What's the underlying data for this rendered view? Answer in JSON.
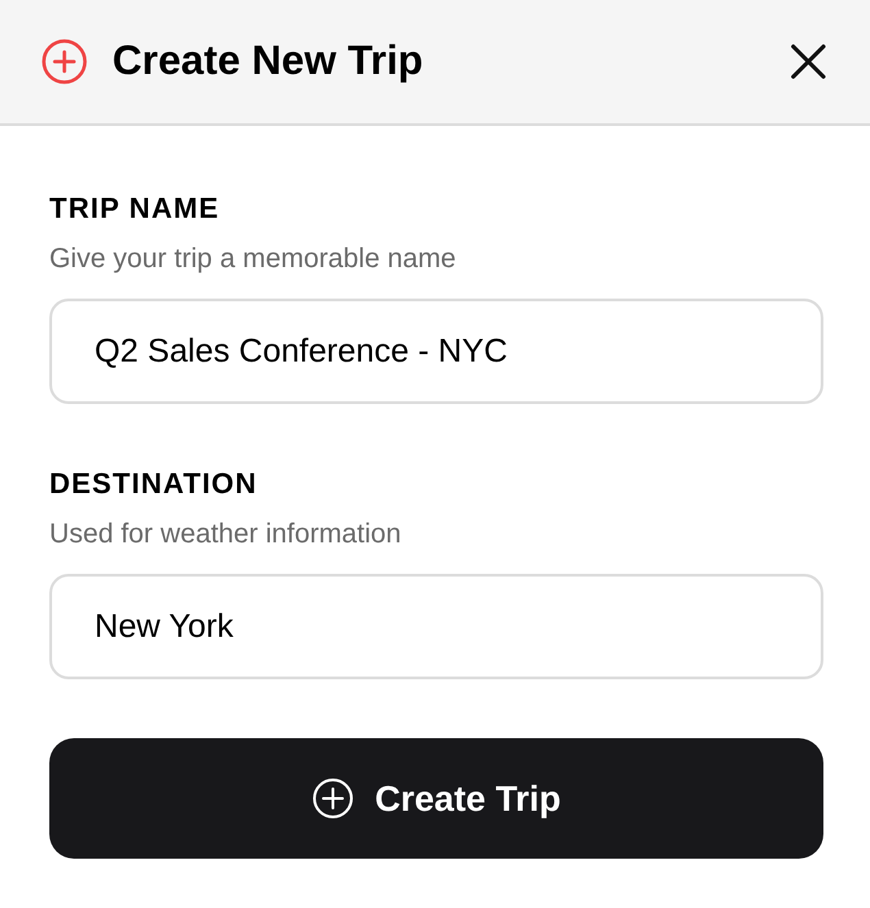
{
  "header": {
    "title": "Create New Trip"
  },
  "fields": [
    {
      "label": "TRIP NAME",
      "hint": "Give your trip a memorable name",
      "value": "Q2 Sales Conference - NYC"
    },
    {
      "label": "DESTINATION",
      "hint": "Used for weather information",
      "value": "New York"
    }
  ],
  "submit_button": {
    "label": "Create Trip"
  }
}
